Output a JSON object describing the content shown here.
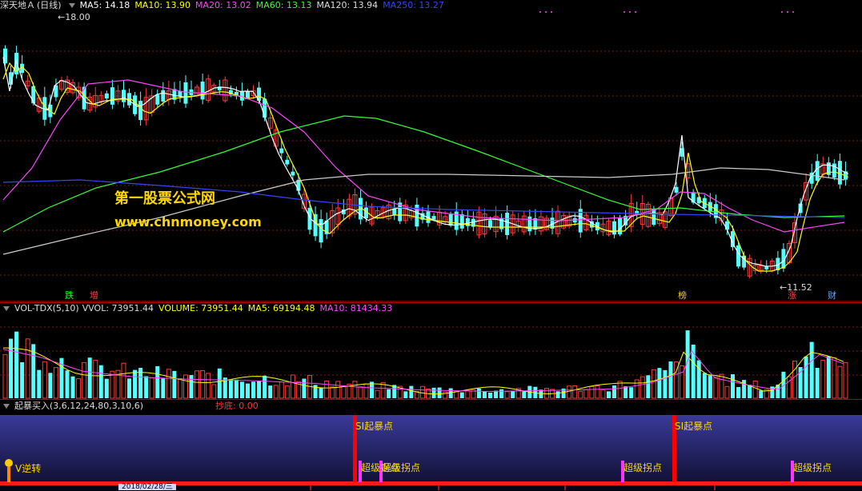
{
  "main": {
    "stock_name": "深天地Ａ",
    "period": "(日线)",
    "ma": [
      {
        "label": "MA5: 14.18",
        "color": "#ffffff"
      },
      {
        "label": "MA10: 13.90",
        "color": "#ffff00"
      },
      {
        "label": "MA20: 13.02",
        "color": "#ff44ff"
      },
      {
        "label": "MA60: 13.13",
        "color": "#33ff33"
      },
      {
        "label": "MA120: 13.94",
        "color": "#dddddd"
      },
      {
        "label": "MA250: 13.27",
        "color": "#3344ff"
      }
    ],
    "high_marker": "18.00",
    "low_marker": "11.52",
    "event_badges": [
      {
        "text": "跌",
        "color": "#00ff00"
      },
      {
        "text": "增",
        "color": "#ff4444"
      },
      {
        "text": "榜",
        "color": "#ffcc00"
      },
      {
        "text": "涨",
        "color": "#ff4444"
      },
      {
        "text": "财",
        "color": "#66aaff"
      }
    ],
    "watermark_title": "第一股票公式网",
    "watermark_url": "www.chnmoney.com"
  },
  "volume": {
    "indicator": "VOL-TDX(5,10)",
    "vvol": "VVOL: 73951.44",
    "volume": "VOLUME: 73951.44",
    "ma5": "MA5: 69194.48",
    "ma10": "MA10: 81434.33",
    "colors": {
      "vvol": "#dddddd",
      "volume": "#ffff00",
      "ma5": "#ffff00",
      "ma10": "#ff44ff"
    }
  },
  "signal": {
    "indicator": "起暴买入",
    "params": "(3,6,12,24,80,3,10,6)",
    "bottom_label": "抄底: 0.00",
    "labels": {
      "reversal": "V逆转",
      "si_1": "SI起暴点",
      "si_2": "SI起暴点",
      "super_1": "超级拐点",
      "super_2": "超级拐点",
      "super_3": "超级拐点",
      "super_4": "超级拐点"
    }
  },
  "axis": {
    "date_label": "2018/02/28/三"
  }
}
